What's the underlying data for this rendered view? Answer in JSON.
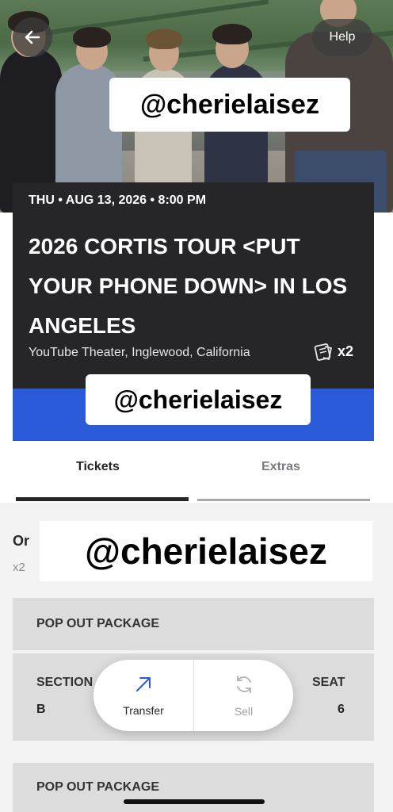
{
  "header": {
    "help_label": "Help"
  },
  "watermarks": {
    "top": "@cherielaisez",
    "middle": "@cherielaisez",
    "bottom": "@cherielaisez"
  },
  "event": {
    "date_line": "THU • AUG 13, 2026 • 8:00 PM",
    "title": "2026 CORTIS TOUR <PUT YOUR PHONE DOWN> IN LOS ANGELES",
    "venue": "YouTube Theater, Inglewood, California",
    "quantity": "x2",
    "accent_color": "#2b5ad8"
  },
  "tabs": [
    {
      "label": "Tickets",
      "active": true
    },
    {
      "label": "Extras",
      "active": false
    }
  ],
  "order": {
    "label": "Or",
    "quantity": "x2"
  },
  "packages": [
    {
      "label": "POP OUT PACKAGE"
    },
    {
      "label": "POP OUT PACKAGE"
    }
  ],
  "ticket": {
    "section_label": "SECTION",
    "section_value": "B",
    "seat_label": "SEAT",
    "seat_value": "6"
  },
  "actions": {
    "transfer_label": "Transfer",
    "sell_label": "Sell"
  }
}
